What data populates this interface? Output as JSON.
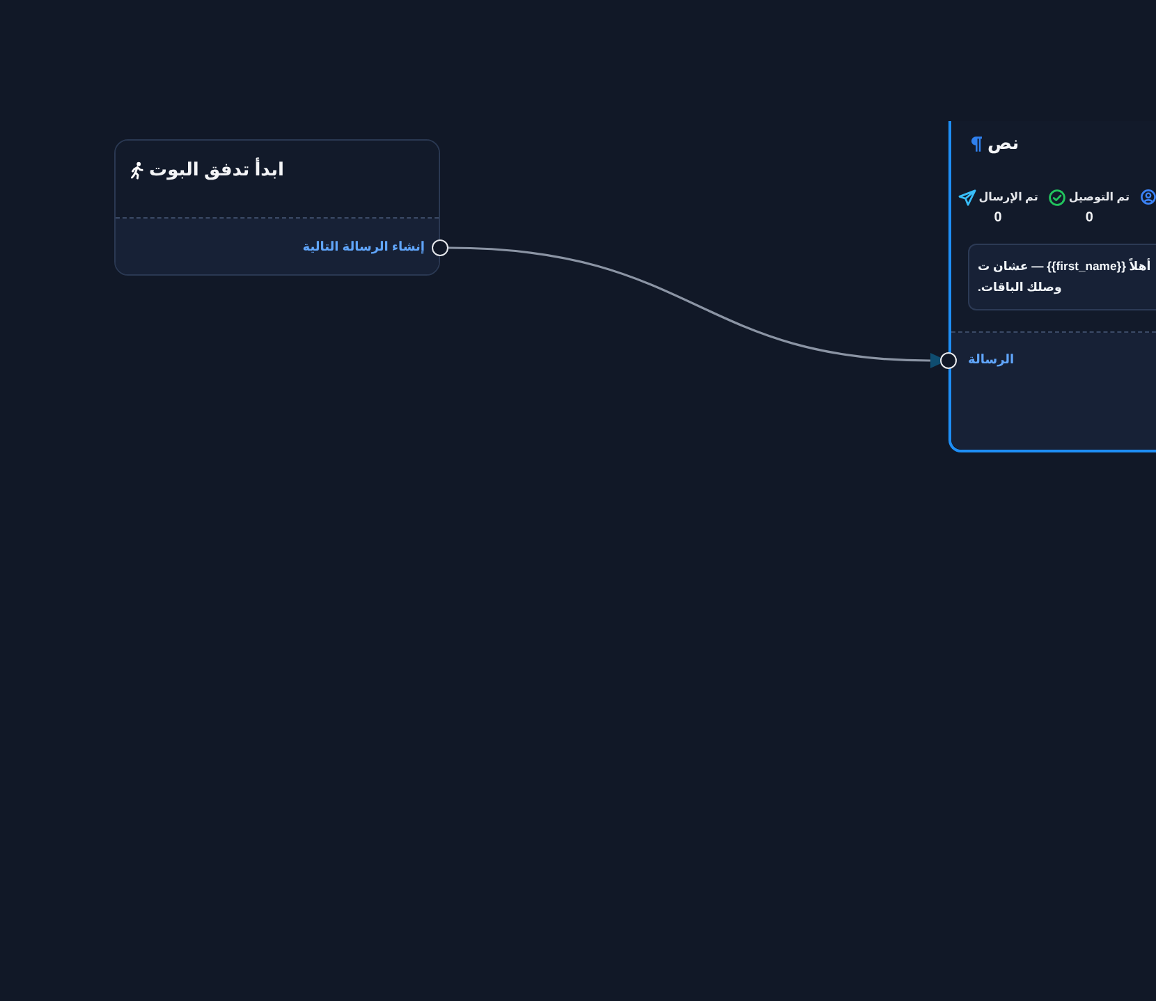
{
  "nodes": [
    {
      "kind": "start",
      "title": "ابدأ تدفق البوت",
      "selected": false,
      "output": {
        "label": "إنشاء الرسالة التالية",
        "connected": true
      }
    },
    {
      "kind": "text",
      "title": "نص",
      "selected": true,
      "stats": [
        {
          "kind": "user"
        },
        {
          "kind": "delivered",
          "label": "تم التوصيل",
          "value": "0"
        },
        {
          "kind": "sent",
          "label": "تم الإرسال",
          "value": "0"
        }
      ],
      "message": "أهلاً {{first_name}} — عشان ت\nوصلك الباقات.",
      "input": {
        "label": "الرسالة"
      }
    }
  ]
}
